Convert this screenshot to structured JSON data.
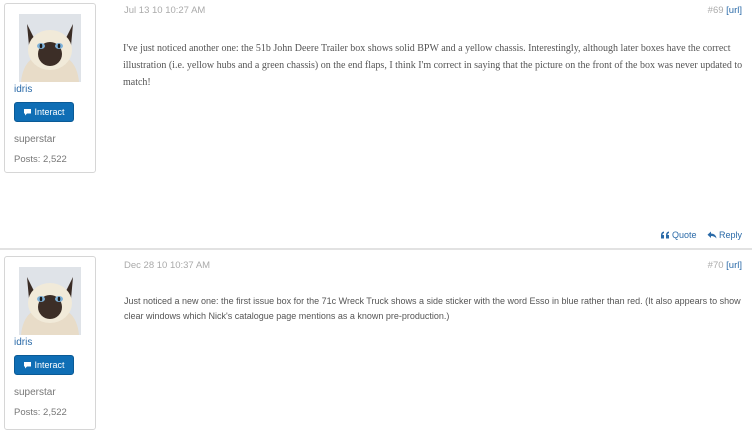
{
  "posts": [
    {
      "author": {
        "username": "idris",
        "interact_label": "Interact",
        "rank": "superstar",
        "posts": "Posts: 2,522"
      },
      "date": "Jul 13 10 10:27 AM",
      "number": "#69",
      "url_label": "[url]",
      "body": "I've just noticed another one: the 51b John Deere Trailer box shows solid BPW and a yellow chassis. Interestingly, although later boxes have the correct illustration (i.e. yellow hubs and a green chassis) on the end flaps, I think I'm correct in saying that the picture on the front of the box was never updated to match!",
      "actions": {
        "quote": "Quote",
        "reply": "Reply"
      }
    },
    {
      "author": {
        "username": "idris",
        "interact_label": "Interact",
        "rank": "superstar",
        "posts": "Posts: 2,522"
      },
      "date": "Dec 28 10 10:37 AM",
      "number": "#70",
      "url_label": "[url]",
      "body": "Just noticed a new one: the first issue box for the 71c Wreck Truck shows a side sticker with the word Esso in blue rather than red. (It also appears to show clear windows which Nick's catalogue page mentions as a known pre-production.)"
    }
  ],
  "icons": {
    "interact": "chat-bubble-icon",
    "quote": "quote-icon",
    "reply": "reply-arrow-icon"
  },
  "colors": {
    "link": "#2a6aa8",
    "button": "#0f6eb5"
  }
}
